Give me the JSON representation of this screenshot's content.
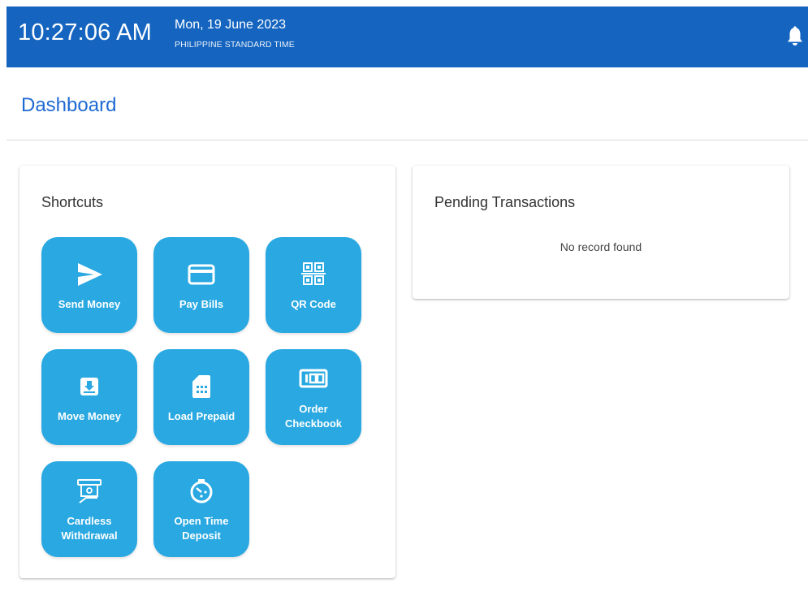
{
  "header": {
    "time": "10:27:06 AM",
    "date": "Mon, 19 June 2023",
    "timezone": "PHILIPPINE STANDARD TIME",
    "notification_icon": "bell-icon"
  },
  "page": {
    "title": "Dashboard"
  },
  "shortcuts": {
    "title": "Shortcuts",
    "items": [
      {
        "label": "Send Money",
        "icon": "send-icon"
      },
      {
        "label": "Pay Bills",
        "icon": "credit-card-icon"
      },
      {
        "label": "QR Code",
        "icon": "qr-code-icon"
      },
      {
        "label": "Move Money",
        "icon": "move-money-icon"
      },
      {
        "label": "Load Prepaid",
        "icon": "sim-card-icon"
      },
      {
        "label": "Order Checkbook",
        "icon": "checkbook-icon"
      },
      {
        "label": "Cardless Withdrawal",
        "icon": "atm-withdrawal-icon"
      },
      {
        "label": "Open Time Deposit",
        "icon": "time-deposit-icon"
      }
    ]
  },
  "pending": {
    "title": "Pending Transactions",
    "empty_message": "No record found"
  },
  "colors": {
    "header_bg": "#1565c0",
    "title_blue": "#1e6ad3",
    "tile_bg": "#29a8e1"
  }
}
